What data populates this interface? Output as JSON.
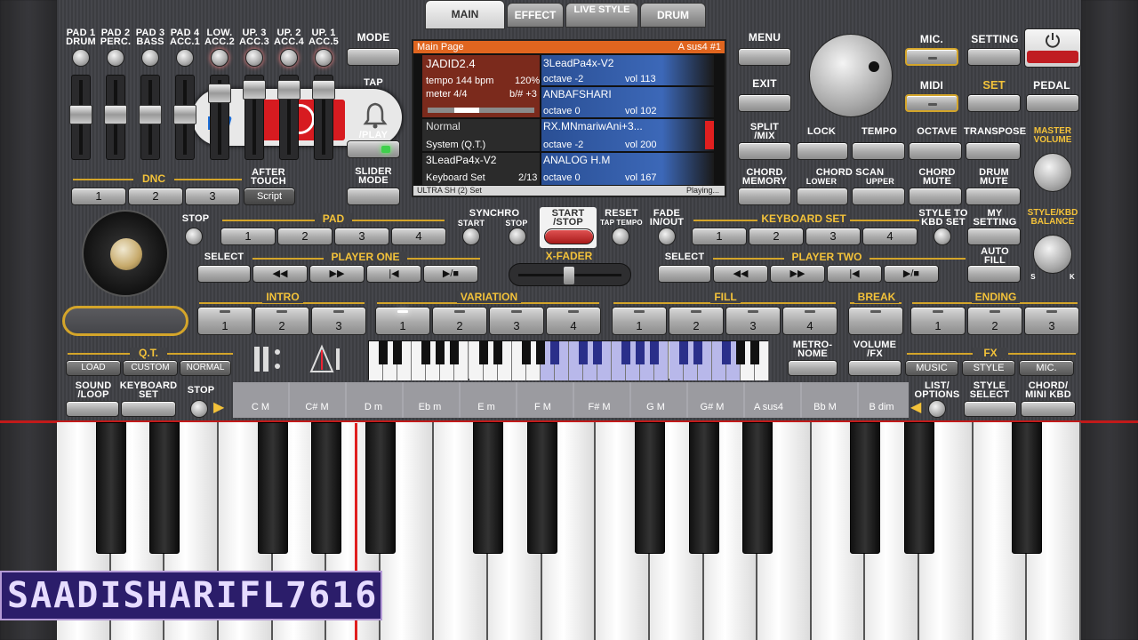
{
  "tabs": [
    {
      "label": "MAIN"
    },
    {
      "label": "EFFECT"
    },
    {
      "label": "LIVE STYLE"
    },
    {
      "label": "DRUM"
    }
  ],
  "pads": [
    {
      "top": "PAD 1",
      "bottom": "DRUM"
    },
    {
      "top": "PAD 2",
      "bottom": "PERC."
    },
    {
      "top": "PAD 3",
      "bottom": "BASS"
    },
    {
      "top": "PAD 4",
      "bottom": "ACC.1"
    },
    {
      "top": "LOW.",
      "bottom": "ACC.2"
    },
    {
      "top": "UP. 3",
      "bottom": "ACC.3"
    },
    {
      "top": "UP. 2",
      "bottom": "ACC.4"
    },
    {
      "top": "UP. 1",
      "bottom": "ACC.5"
    }
  ],
  "left_buttons": {
    "mode": "MODE",
    "tap": "TAP",
    "play": "/PLAY",
    "slider_mode_1": "SLIDER",
    "slider_mode_2": "MODE"
  },
  "dnc": {
    "label": "DNC",
    "b1": "1",
    "b2": "2",
    "b3": "3",
    "after_touch_1": "AFTER",
    "after_touch_2": "TOUCH",
    "script": "Script"
  },
  "screen": {
    "title": "Main Page",
    "chord": "A sus4 #1",
    "style_name": "JADID2.4",
    "tempo": "tempo 144 bpm",
    "tempo_pct": "120%",
    "meter": "meter 4/4",
    "transpose": "b/# +3",
    "up1_name": "3LeadPa4x-V2",
    "up1_oct": "octave -2",
    "up1_vol": "vol 113",
    "up2_name": "ANBAFSHARI",
    "up2_oct": "octave  0",
    "up2_vol": "vol 102",
    "sys_mode": "Normal",
    "sys_sub": "System (Q.T.)",
    "up3_name": "RX.MNmariwAni+3...",
    "up3_oct": "octave -2",
    "up3_vol": "vol 200",
    "kbd_name": "3LeadPa4x-V2",
    "kbd_set": "Keyboard Set",
    "kbd_idx": "2/13",
    "low_name": "ANALOG H.M",
    "low_oct": "octave  0",
    "low_vol": "vol 167",
    "footer_left": "ULTRA SH (2) Set",
    "footer_right": "Playing..."
  },
  "right_top": {
    "menu": "MENU",
    "exit": "EXIT",
    "split1": "SPLIT",
    "split2": "/MIX",
    "chordmem1": "CHORD",
    "chordmem2": "MEMORY",
    "mic": "MIC.",
    "setting": "SETTING",
    "midi": "MIDI",
    "set": "SET",
    "pedal": "PEDAL",
    "lock": "LOCK",
    "tempo": "TEMPO",
    "octave": "OCTAVE",
    "transpose": "TRANSPOSE",
    "master1": "MASTER",
    "master2": "VOLUME",
    "chordscan": "CHORD SCAN",
    "lower": "LOWER",
    "upper": "UPPER",
    "chordmute1": "CHORD",
    "chordmute2": "MUTE",
    "drummute1": "DRUM",
    "drummute2": "MUTE"
  },
  "middle": {
    "stop": "STOP",
    "pad": "PAD",
    "p1": "1",
    "p2": "2",
    "p3": "3",
    "p4": "4",
    "synchro": "SYNCHRO",
    "sync_start": "START",
    "sync_stop": "STOP",
    "startstop1": "START",
    "startstop2": "/STOP",
    "reset": "RESET",
    "taptempo": "TAP TEMPO",
    "fade1": "FADE",
    "fade2": "IN/OUT",
    "kbdset": "KEYBOARD SET",
    "k1": "1",
    "k2": "2",
    "k3": "3",
    "k4": "4",
    "styleto1": "STYLE TO",
    "styleto2": "KBD SET",
    "mysetting1": "MY",
    "mysetting2": "SETTING",
    "stylekbd1": "STYLE/KBD",
    "stylekbd2": "BALANCE",
    "s": "S",
    "k": "K",
    "select": "SELECT",
    "player_one": "PLAYER ONE",
    "xfader": "X-FADER",
    "player_two": "PLAYER TWO",
    "autofill1": "AUTO",
    "autofill2": "FILL"
  },
  "sections": {
    "intro": "INTRO",
    "variation": "VARIATION",
    "fill": "FILL",
    "break": "BREAK",
    "ending": "ENDING"
  },
  "lower": {
    "qt": "Q.T.",
    "load": "LOAD",
    "custom": "CUSTOM",
    "normal": "NORMAL",
    "metro1": "METRO-",
    "metro2": "NOME",
    "volfx1": "VOLUME",
    "volfx2": "/FX",
    "fx": "FX",
    "music": "MUSIC",
    "style": "STYLE",
    "mic": "MIC.",
    "sound1": "SOUND",
    "sound2": "/LOOP",
    "kbdset1": "KEYBOARD",
    "kbdset2": "SET",
    "stop": "STOP",
    "list1": "LIST/",
    "list2": "OPTIONS",
    "stylesel1": "STYLE",
    "stylesel2": "SELECT",
    "chordmini1": "CHORD/",
    "chordmini2": "MINI KBD"
  },
  "chords": [
    "C M",
    "C# M",
    "D m",
    "Eb m",
    "E m",
    "F M",
    "F# M",
    "G M",
    "G# M",
    "A sus4",
    "Bb M",
    "B dim"
  ],
  "watermark": "SAADISHARIFL7616",
  "colors": {
    "accent": "#f3c23a",
    "screen_header": "#e0651f",
    "active_red": "#d0202a"
  }
}
